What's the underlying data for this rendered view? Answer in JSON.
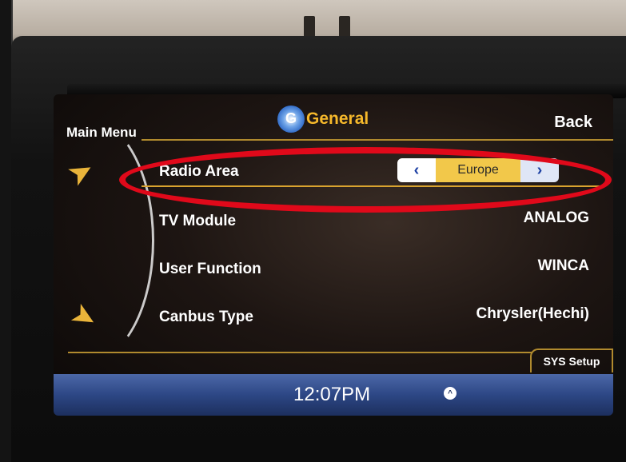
{
  "header": {
    "main_menu_label": "Main Menu",
    "title": "General",
    "back_label": "Back"
  },
  "settings": {
    "radio_area": {
      "label": "Radio Area",
      "value": "Europe",
      "prev": "‹",
      "next": "›"
    },
    "tv_module": {
      "label": "TV Module",
      "value": "ANALOG"
    },
    "user_function": {
      "label": "User Function",
      "value": "WINCA"
    },
    "canbus_type": {
      "label": "Canbus Type",
      "value": "Chrysler(Hechi)"
    }
  },
  "tabs": {
    "sys_setup": "SYS Setup"
  },
  "status_bar": {
    "time": "12:07PM",
    "up_glyph": "^"
  },
  "icons": {
    "scroll_up": "arrow-up-icon",
    "scroll_down": "arrow-down-icon",
    "title": "gear-icon"
  },
  "colors": {
    "accent_gold": "#f5b82b",
    "highlight_red": "#e0091a",
    "status_blue": "#2d4785"
  }
}
